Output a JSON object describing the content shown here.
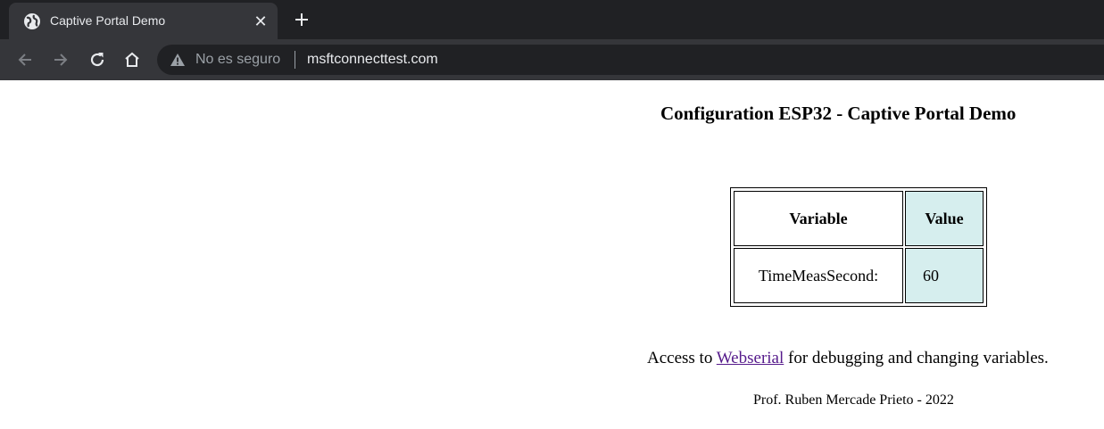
{
  "browser": {
    "tab": {
      "title": "Captive Portal Demo",
      "close_glyph": "✕"
    },
    "omnibox": {
      "security_label": "No es seguro",
      "url": "msftconnecttest.com"
    },
    "icons": {
      "favicon": "globe-icon",
      "new_tab": "plus-icon",
      "back": "arrow-left-icon",
      "forward": "arrow-right-icon",
      "reload": "reload-icon",
      "home": "home-icon",
      "warning": "warning-icon"
    },
    "colors": {
      "tabstrip": "#202124",
      "toolbar": "#35363a",
      "link_visited": "#551a8b",
      "value_cell_bg": "#d6eeee"
    }
  },
  "page": {
    "title": "Configuration ESP32 - Captive Portal Demo",
    "table": {
      "headers": {
        "variable": "Variable",
        "value": "Value"
      },
      "rows": [
        {
          "variable": "TimeMeasSecond:",
          "value": "60"
        }
      ]
    },
    "access": {
      "prefix": "Access to",
      "link_text": "Webserial",
      "suffix": "for debugging and changing variables."
    },
    "footer": "Prof. Ruben Mercade Prieto - 2022"
  }
}
